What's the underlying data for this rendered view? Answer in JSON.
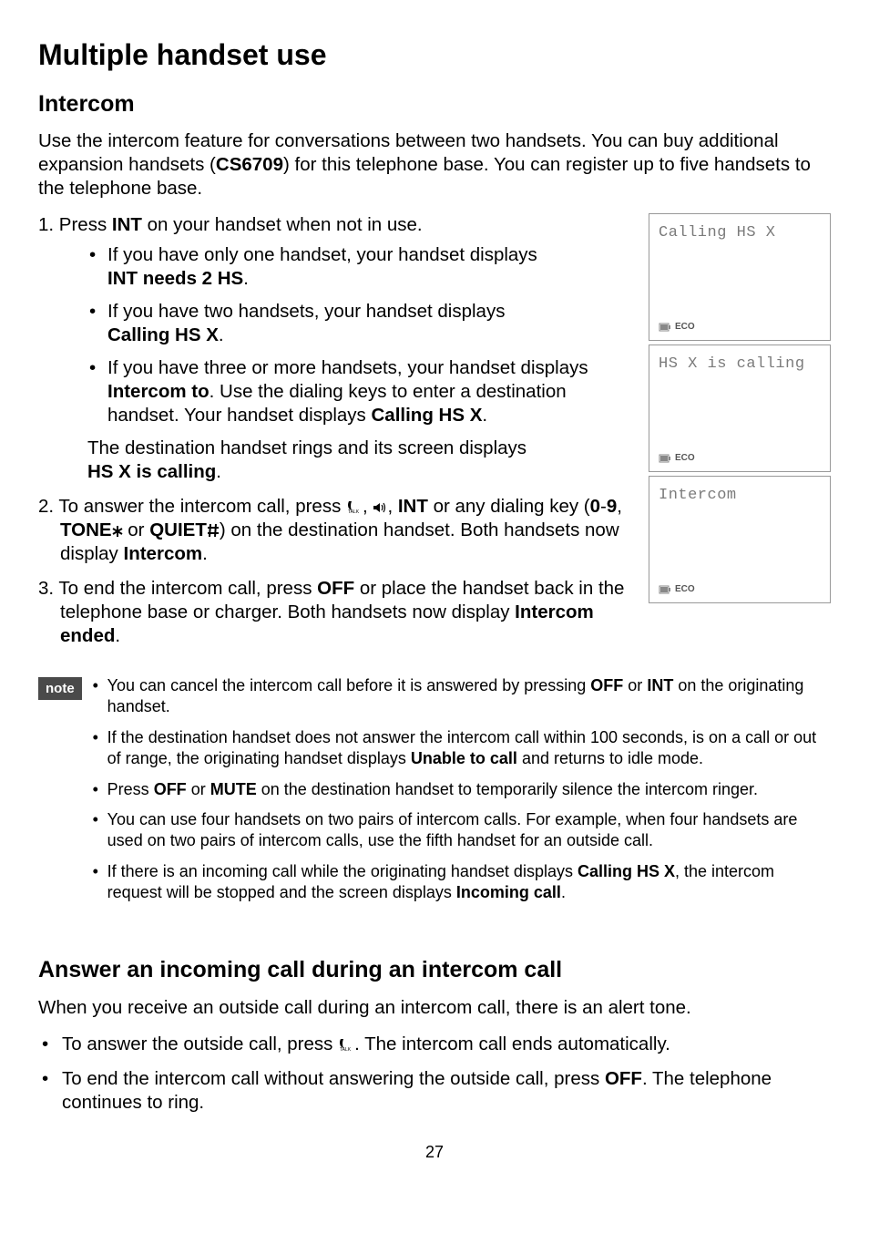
{
  "title": "Multiple handset use",
  "section1": {
    "heading": "Intercom",
    "intro_pre": "Use the intercom feature for conversations between two handsets. You can buy additional expansion handsets (",
    "intro_model": "CS6709",
    "intro_post": ") for this telephone base. You can register up to five handsets to the telephone base.",
    "step1": {
      "pre": "1. Press ",
      "key": "INT",
      "post": " on your handset when not in use.",
      "b1_pre": "If you have only one handset, your handset displays ",
      "b1_bold": "INT needs 2 HS",
      "b1_post": ".",
      "b2_pre": "If you have two handsets, your handset displays ",
      "b2_bold": "Calling HS X",
      "b2_post": ".",
      "b3_pre": "If you have three or more handsets, your handset displays ",
      "b3_bold1": "Intercom to",
      "b3_mid": ". Use the dialing keys to enter a destination handset. Your handset displays ",
      "b3_bold2": "Calling HS X",
      "b3_post": ".",
      "sub_pre": "The destination handset rings and its screen displays ",
      "sub_bold": "HS X is calling",
      "sub_post": "."
    },
    "step2": {
      "pre": "2. To answer the intercom call, press ",
      "mid1": ", ",
      "mid2": ", ",
      "key_int": "INT",
      "mid3": " or any dialing key (",
      "keys_09": "0",
      "dash": "-",
      "keys_9": "9",
      "comma": ", ",
      "key_tone": "TONE",
      "or": " or ",
      "key_quiet": "QUIET",
      "mid4": ") on the destination handset. Both handsets now display ",
      "bold_intercom": "Intercom",
      "post": "."
    },
    "step3": {
      "pre": "3. To end the intercom call, press ",
      "key_off": "OFF",
      "mid": " or place the handset back in the telephone base or charger. Both handsets now display ",
      "bold": "Intercom ended",
      "post": "."
    }
  },
  "screens": {
    "s1": "Calling HS X",
    "s2": "HS X is calling",
    "s3": "Intercom",
    "eco": "ECO"
  },
  "note": {
    "label": "note",
    "n1_pre": "You can cancel the intercom call before it is answered by pressing ",
    "n1_off": "OFF",
    "n1_or": " or ",
    "n1_int": "INT",
    "n1_post": " on the originating handset.",
    "n2_pre": "If the destination handset does not answer the intercom call within 100 seconds, is on a call or out of range, the originating handset displays ",
    "n2_bold": "Unable to call",
    "n2_post": " and returns to idle mode.",
    "n3_pre": "Press ",
    "n3_off": "OFF",
    "n3_or": " or ",
    "n3_mute": "MUTE",
    "n3_post": " on the destination handset to temporarily silence the intercom ringer.",
    "n4": "You can use four handsets on two pairs of intercom calls. For example, when four handsets are used on two pairs of intercom calls, use the fifth handset for an outside call.",
    "n5_pre": "If there is an incoming call while the originating handset displays ",
    "n5_bold1": "Calling HS X",
    "n5_mid": ", the intercom request will be stopped and the screen displays ",
    "n5_bold2": "Incoming call",
    "n5_post": "."
  },
  "section2": {
    "heading": "Answer an incoming call during an intercom call",
    "intro": "When you receive an outside call during an intercom call, there is an alert tone.",
    "b1_pre": "To answer the outside call, press ",
    "b1_post": ". The intercom call ends automatically.",
    "b2_pre": "To end the intercom call without answering the outside call, press ",
    "b2_off": "OFF",
    "b2_post": ". The telephone continues to ring."
  },
  "page": "27"
}
